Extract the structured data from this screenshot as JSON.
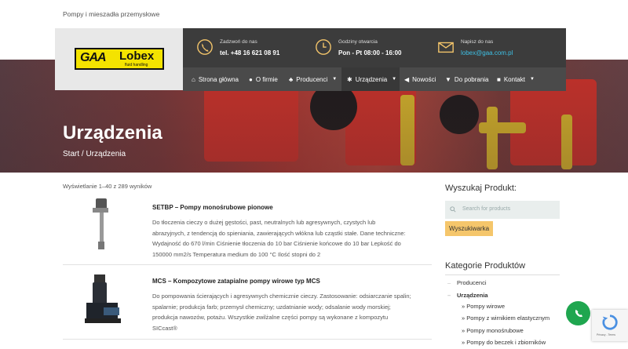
{
  "header": {
    "tagline": "Pompy i mieszadła przemysłowe",
    "logo": {
      "gaa": "GAA",
      "lobex": "Lobex",
      "sub": "fluid handling"
    },
    "phone": {
      "label": "Zadzwoń do nas",
      "value": "tel. +48 16 621 08 91"
    },
    "hours": {
      "label": "Godziny otwarcia",
      "value": "Pon - Pt 08:00 - 16:00"
    },
    "email": {
      "label": "Napisz do nas",
      "value": "lobex@gaa.com.pl"
    }
  },
  "nav": {
    "items": [
      {
        "label": "Strona główna",
        "icon": "home-icon"
      },
      {
        "label": "O firmie",
        "icon": "info-icon"
      },
      {
        "label": "Producenci",
        "icon": "users-icon",
        "has_dropdown": true
      },
      {
        "label": "Urządzenia",
        "icon": "gear-icon",
        "has_dropdown": true,
        "active": true
      },
      {
        "label": "Nowości",
        "icon": "megaphone-icon"
      },
      {
        "label": "Do pobrania",
        "icon": "download-icon"
      },
      {
        "label": "Kontakt",
        "icon": "contact-icon",
        "has_dropdown": true
      }
    ]
  },
  "hero": {
    "title": "Urządzenia",
    "breadcrumb": "Start / Urządzenia"
  },
  "results": {
    "count_text": "Wyświetlanie 1–40 z 289 wyników"
  },
  "products": [
    {
      "title": "SETBP – Pompy monośrubowe pionowe",
      "desc_lines": [
        "Do tłoczenia cieczy o dużej gęstości, past, neutralnych lub agresywnych, czystych lub",
        "abrazyjnych, z tendencją do spieniania, zawierających włókna lub cząstki stałe. Dane techniczne:",
        "Wydajność do 670 l/min Ciśnienie tłoczenia do 10 bar Ciśnienie końcowe do 10 bar Lepkość do",
        "150000 mm2/s Temperatura medium do 100 °C Ilość stopni do 2"
      ]
    },
    {
      "title": "MCS – Kompozytowe zatapialne pompy wirowe typ MCS",
      "desc_lines": [
        "Do pompowania ścierających i agresywnych chemicznie cieczy. Zastosowanie: odsiarczanie spalin;",
        "spalarnie; produkcja farb; przemysł chemiczny; uzdatnianie wody; odsalanie wody morskiej;",
        "produkcja nawozów, potażu. Wszystkie zwilżalne części pompy są wykonane z kompozytu",
        "SICcast®"
      ]
    }
  ],
  "sidebar": {
    "search_title": "Wyszukaj Produkt:",
    "search_placeholder": "Search for products",
    "search_button": "Wyszukiwarka",
    "categories_title": "Kategorie Produktów",
    "categories": [
      {
        "label": "Producenci",
        "level": 0
      },
      {
        "label": "Urządzenia",
        "level": 0,
        "bold": true
      },
      {
        "label": "» Pompy wirowe",
        "level": 1
      },
      {
        "label": "» Pompy z wirnikiem elastycznym",
        "level": 1
      },
      {
        "label": "» Pompy monośrubowe",
        "level": 1
      },
      {
        "label": "» Pompy do beczek i zbiorników",
        "level": 1
      }
    ]
  },
  "widgets": {
    "captcha_text": "Privacy - Terms"
  },
  "colors": {
    "accent": "#f5c66b",
    "link": "#3ec0e5",
    "whatsapp": "#1fa64f",
    "header_dark": "#3c3c3c"
  }
}
